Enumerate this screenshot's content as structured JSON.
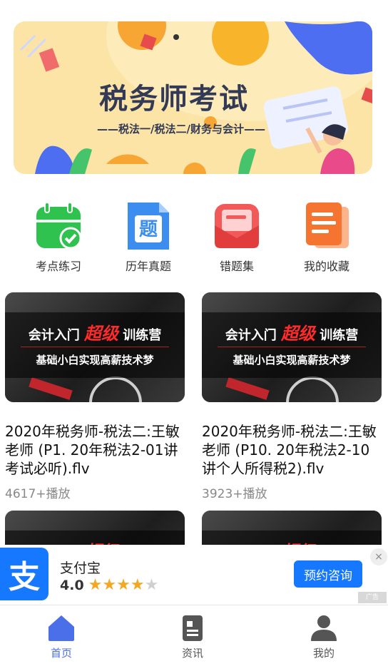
{
  "banner": {
    "title": "税务师考试",
    "subtitle": "——税法一/税法二/财务与会计——"
  },
  "quick_nav": [
    {
      "label": "考点练习",
      "icon": "calendar-check-icon"
    },
    {
      "label": "历年真题",
      "icon": "exam-doc-icon"
    },
    {
      "label": "错题集",
      "icon": "mistakes-envelope-icon"
    },
    {
      "label": "我的收藏",
      "icon": "favorites-docs-icon"
    }
  ],
  "thumbnail": {
    "line1_pre": "会计入门",
    "line1_highlight": "超级",
    "line1_post": "训练营",
    "line2": "基础小白实现高薪技术梦"
  },
  "videos": [
    {
      "title": "2020年税务师-税法二:王敏老师 (P1. 20年税法2-01讲考试必听).flv",
      "plays": "4617+播放"
    },
    {
      "title": "2020年税务师-税法二:王敏老师 (P10. 20年税法2-10讲个人所得税2).flv",
      "plays": "3923+播放"
    }
  ],
  "ad": {
    "logo_char": "支",
    "name": "支付宝",
    "rating": "4.0",
    "stars_filled": 4,
    "stars_total": 5,
    "button": "预约咨询",
    "close": "×",
    "tag": "广告"
  },
  "tabs": [
    {
      "label": "首页",
      "icon": "home-icon",
      "active": true
    },
    {
      "label": "资讯",
      "icon": "news-icon",
      "active": false
    },
    {
      "label": "我的",
      "icon": "user-icon",
      "active": false
    }
  ],
  "colors": {
    "accent": "#4b6fe8",
    "alipay": "#1677ff",
    "star": "#f5a623",
    "star_empty": "#d0d0d0"
  }
}
